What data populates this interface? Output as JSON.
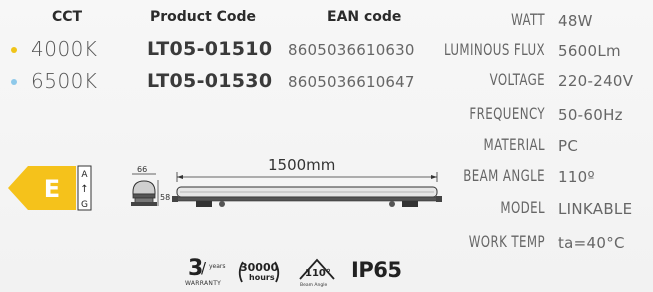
{
  "headers": {
    "cct": "CCT",
    "product_code": "Product Code",
    "ean": "EAN code"
  },
  "rows": [
    {
      "cct": "4000K",
      "code": "LT05-01510",
      "ean": "8605036610630",
      "dot_color": "#f0c419"
    },
    {
      "cct": "6500K",
      "code": "LT05-01530",
      "ean": "8605036610647",
      "dot_color": "#8ec9ea"
    }
  ],
  "specs": [
    {
      "label": "WATT",
      "value": "48W"
    },
    {
      "label": "LUMINOUS FLUX",
      "value": "5600Lm"
    },
    {
      "label": "VOLTAGE",
      "value": "220-240V"
    },
    {
      "label": "FREQUENCY",
      "value": "50-60Hz"
    },
    {
      "label": "MATERIAL",
      "value": "PC"
    },
    {
      "label": "BEAM ANGLE",
      "value": "110º"
    },
    {
      "label": "MODEL",
      "value": "LINKABLE"
    },
    {
      "label": "WORK TEMP",
      "value": "ta=40°C"
    }
  ],
  "energy": {
    "class": "E",
    "scale_top": "A",
    "scale_bottom": "G",
    "color": "#f5c21b"
  },
  "drawing": {
    "length": "1500mm",
    "width": "66",
    "height": "58"
  },
  "badges": {
    "warranty_number": "3",
    "warranty_unit": "years",
    "warranty_label": "WARRANTY",
    "hours_number": "30000",
    "hours_label": "hours",
    "beam_number": "110°",
    "beam_label": "Beam Angle",
    "ip": "IP65"
  },
  "colors": {
    "energy_yellow": "#f5c21b",
    "dot_warm": "#f0c419",
    "dot_cool": "#8ec9ea"
  }
}
